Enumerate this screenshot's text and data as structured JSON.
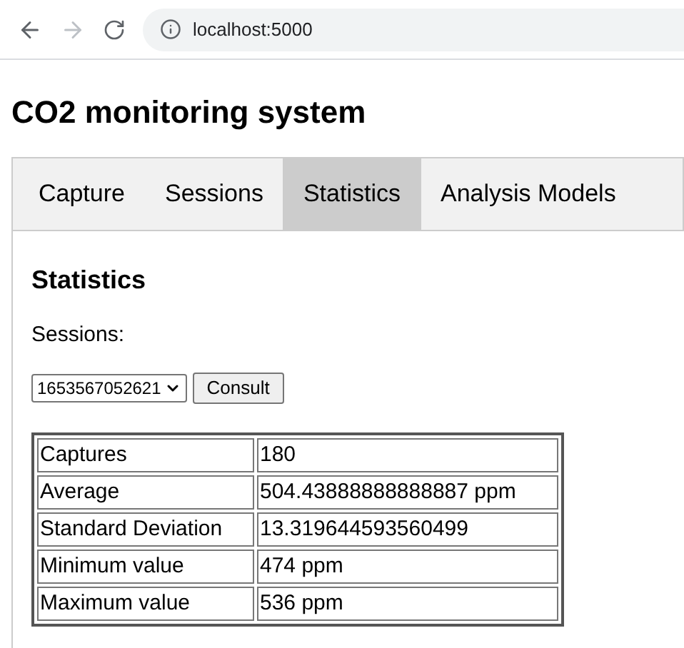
{
  "browser": {
    "url": "localhost:5000"
  },
  "title": "CO2 monitoring system",
  "tabs": [
    {
      "label": "Capture",
      "selected": false
    },
    {
      "label": "Sessions",
      "selected": false
    },
    {
      "label": "Statistics",
      "selected": true
    },
    {
      "label": "Analysis Models",
      "selected": false
    }
  ],
  "panel": {
    "heading": "Statistics",
    "sessions_label": "Sessions:",
    "session_select": "1653567052621",
    "consult_button": "Consult"
  },
  "table": {
    "rows": [
      [
        "Captures",
        "180"
      ],
      [
        "Average",
        "504.43888888888887 ppm"
      ],
      [
        "Standard Deviation",
        "13.319644593560499"
      ],
      [
        "Minimum value",
        "474 ppm"
      ],
      [
        "Maximum value",
        "536 ppm"
      ]
    ]
  }
}
